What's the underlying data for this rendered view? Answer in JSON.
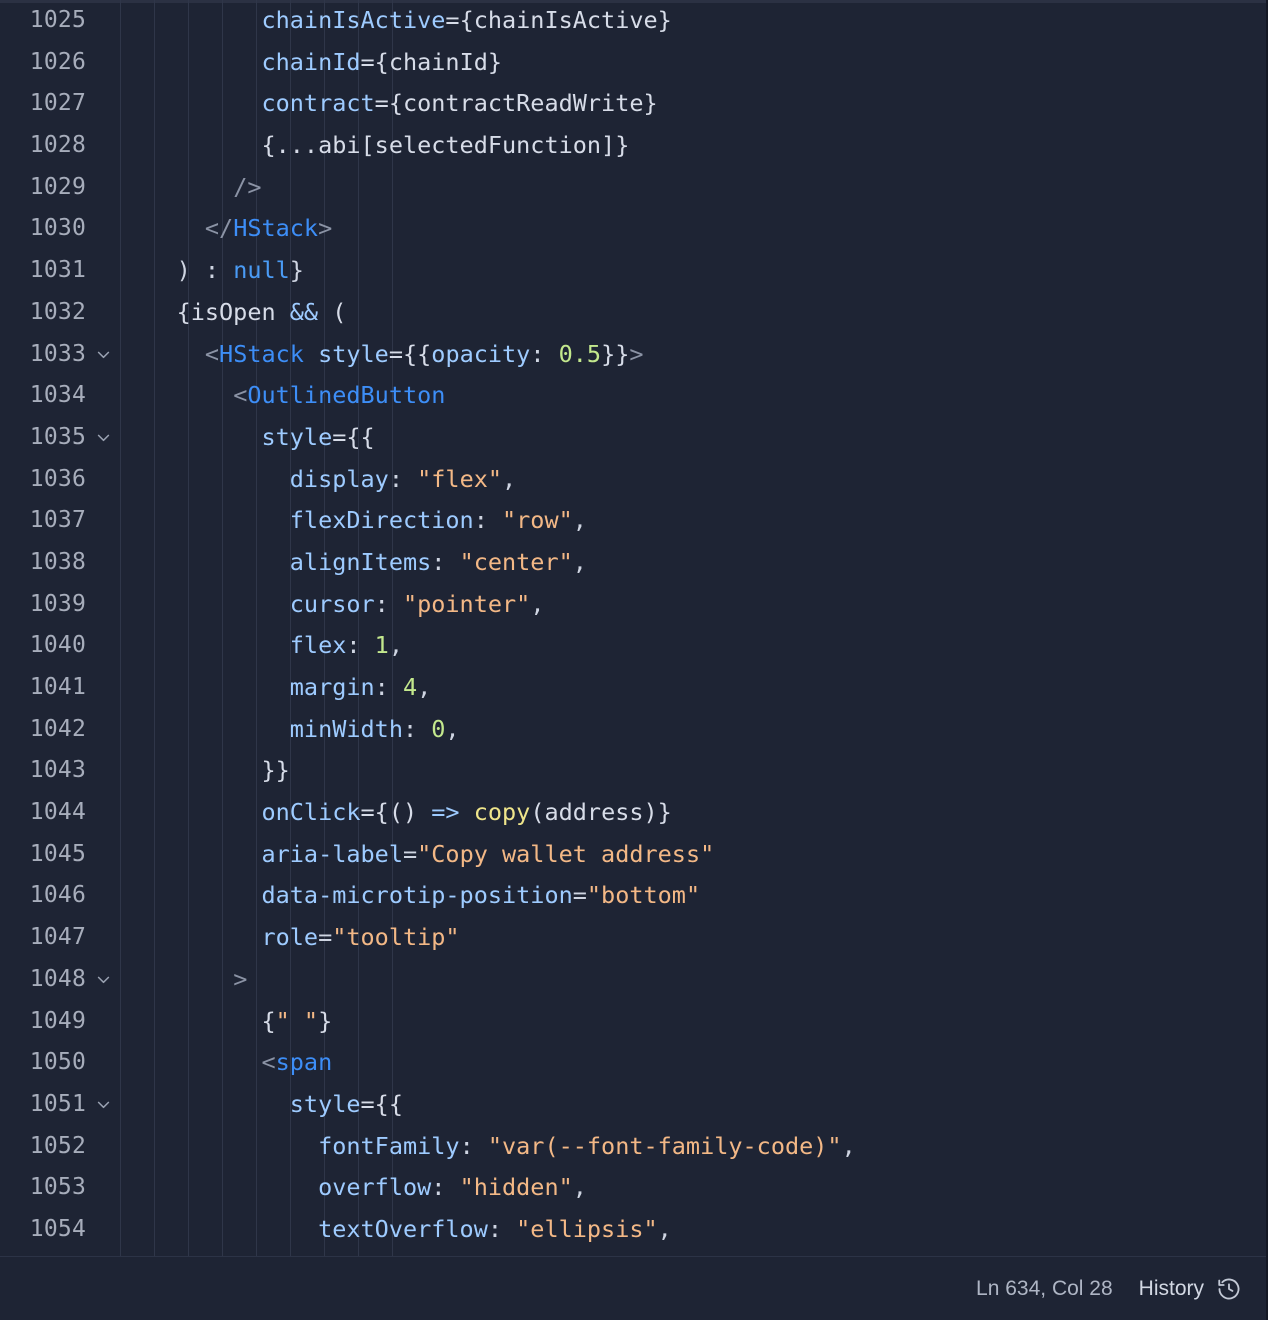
{
  "editor": {
    "language": "jsx",
    "theme_background": "#1e2434",
    "indent_guide_color": "#2f3649",
    "first_line_number": 1025,
    "indent_guide_x": [
      120,
      154,
      188,
      222,
      256,
      290,
      324,
      358,
      392
    ],
    "lines": [
      {
        "number": "1025",
        "fold": false,
        "tokens": [
          {
            "text": "          ",
            "kind": "plain"
          },
          {
            "text": "chainIsActive",
            "kind": "attr"
          },
          {
            "text": "={chainIsActive}",
            "kind": "plain"
          }
        ]
      },
      {
        "number": "1026",
        "fold": false,
        "tokens": [
          {
            "text": "          ",
            "kind": "plain"
          },
          {
            "text": "chainId",
            "kind": "attr"
          },
          {
            "text": "={chainId}",
            "kind": "plain"
          }
        ]
      },
      {
        "number": "1027",
        "fold": false,
        "tokens": [
          {
            "text": "          ",
            "kind": "plain"
          },
          {
            "text": "contract",
            "kind": "attr"
          },
          {
            "text": "={contractReadWrite}",
            "kind": "plain"
          }
        ]
      },
      {
        "number": "1028",
        "fold": false,
        "tokens": [
          {
            "text": "          ",
            "kind": "plain"
          },
          {
            "text": "{...abi[selectedFunction]}",
            "kind": "plain"
          }
        ]
      },
      {
        "number": "1029",
        "fold": false,
        "tokens": [
          {
            "text": "        ",
            "kind": "plain"
          },
          {
            "text": "/>",
            "kind": "bracket"
          }
        ]
      },
      {
        "number": "1030",
        "fold": false,
        "tokens": [
          {
            "text": "      ",
            "kind": "plain"
          },
          {
            "text": "</",
            "kind": "bracket"
          },
          {
            "text": "HStack",
            "kind": "tag"
          },
          {
            "text": ">",
            "kind": "bracket"
          }
        ]
      },
      {
        "number": "1031",
        "fold": false,
        "tokens": [
          {
            "text": "    ",
            "kind": "plain"
          },
          {
            "text": ") : ",
            "kind": "punct"
          },
          {
            "text": "null",
            "kind": "keyword"
          },
          {
            "text": "}",
            "kind": "punct"
          }
        ]
      },
      {
        "number": "1032",
        "fold": false,
        "tokens": [
          {
            "text": "    ",
            "kind": "plain"
          },
          {
            "text": "{isOpen ",
            "kind": "plain"
          },
          {
            "text": "&&",
            "kind": "op"
          },
          {
            "text": " (",
            "kind": "plain"
          }
        ]
      },
      {
        "number": "1033",
        "fold": true,
        "tokens": [
          {
            "text": "      ",
            "kind": "plain"
          },
          {
            "text": "<",
            "kind": "bracket"
          },
          {
            "text": "HStack",
            "kind": "tag"
          },
          {
            "text": " ",
            "kind": "plain"
          },
          {
            "text": "style",
            "kind": "attr"
          },
          {
            "text": "={{",
            "kind": "plain"
          },
          {
            "text": "opacity",
            "kind": "prop"
          },
          {
            "text": ": ",
            "kind": "punct"
          },
          {
            "text": "0.5",
            "kind": "number"
          },
          {
            "text": "}}",
            "kind": "plain"
          },
          {
            "text": ">",
            "kind": "bracket"
          }
        ]
      },
      {
        "number": "1034",
        "fold": false,
        "tokens": [
          {
            "text": "        ",
            "kind": "plain"
          },
          {
            "text": "<",
            "kind": "bracket"
          },
          {
            "text": "OutlinedButton",
            "kind": "tag"
          }
        ]
      },
      {
        "number": "1035",
        "fold": true,
        "tokens": [
          {
            "text": "          ",
            "kind": "plain"
          },
          {
            "text": "style",
            "kind": "attr"
          },
          {
            "text": "={{",
            "kind": "plain"
          }
        ]
      },
      {
        "number": "1036",
        "fold": false,
        "tokens": [
          {
            "text": "            ",
            "kind": "plain"
          },
          {
            "text": "display",
            "kind": "prop"
          },
          {
            "text": ": ",
            "kind": "punct"
          },
          {
            "text": "\"flex\"",
            "kind": "string"
          },
          {
            "text": ",",
            "kind": "punct"
          }
        ]
      },
      {
        "number": "1037",
        "fold": false,
        "tokens": [
          {
            "text": "            ",
            "kind": "plain"
          },
          {
            "text": "flexDirection",
            "kind": "prop"
          },
          {
            "text": ": ",
            "kind": "punct"
          },
          {
            "text": "\"row\"",
            "kind": "string"
          },
          {
            "text": ",",
            "kind": "punct"
          }
        ]
      },
      {
        "number": "1038",
        "fold": false,
        "tokens": [
          {
            "text": "            ",
            "kind": "plain"
          },
          {
            "text": "alignItems",
            "kind": "prop"
          },
          {
            "text": ": ",
            "kind": "punct"
          },
          {
            "text": "\"center\"",
            "kind": "string"
          },
          {
            "text": ",",
            "kind": "punct"
          }
        ]
      },
      {
        "number": "1039",
        "fold": false,
        "tokens": [
          {
            "text": "            ",
            "kind": "plain"
          },
          {
            "text": "cursor",
            "kind": "prop"
          },
          {
            "text": ": ",
            "kind": "punct"
          },
          {
            "text": "\"pointer\"",
            "kind": "string"
          },
          {
            "text": ",",
            "kind": "punct"
          }
        ]
      },
      {
        "number": "1040",
        "fold": false,
        "tokens": [
          {
            "text": "            ",
            "kind": "plain"
          },
          {
            "text": "flex",
            "kind": "prop"
          },
          {
            "text": ": ",
            "kind": "punct"
          },
          {
            "text": "1",
            "kind": "number"
          },
          {
            "text": ",",
            "kind": "punct"
          }
        ]
      },
      {
        "number": "1041",
        "fold": false,
        "tokens": [
          {
            "text": "            ",
            "kind": "plain"
          },
          {
            "text": "margin",
            "kind": "prop"
          },
          {
            "text": ": ",
            "kind": "punct"
          },
          {
            "text": "4",
            "kind": "number"
          },
          {
            "text": ",",
            "kind": "punct"
          }
        ]
      },
      {
        "number": "1042",
        "fold": false,
        "tokens": [
          {
            "text": "            ",
            "kind": "plain"
          },
          {
            "text": "minWidth",
            "kind": "prop"
          },
          {
            "text": ": ",
            "kind": "punct"
          },
          {
            "text": "0",
            "kind": "number"
          },
          {
            "text": ",",
            "kind": "punct"
          }
        ]
      },
      {
        "number": "1043",
        "fold": false,
        "tokens": [
          {
            "text": "          ",
            "kind": "plain"
          },
          {
            "text": "}}",
            "kind": "plain"
          }
        ]
      },
      {
        "number": "1044",
        "fold": false,
        "tokens": [
          {
            "text": "          ",
            "kind": "plain"
          },
          {
            "text": "onClick",
            "kind": "attr"
          },
          {
            "text": "={() ",
            "kind": "plain"
          },
          {
            "text": "=>",
            "kind": "op"
          },
          {
            "text": " ",
            "kind": "plain"
          },
          {
            "text": "copy",
            "kind": "func"
          },
          {
            "text": "(address)}",
            "kind": "plain"
          }
        ]
      },
      {
        "number": "1045",
        "fold": false,
        "tokens": [
          {
            "text": "          ",
            "kind": "plain"
          },
          {
            "text": "aria-label",
            "kind": "attr"
          },
          {
            "text": "=",
            "kind": "punct"
          },
          {
            "text": "\"Copy wallet address\"",
            "kind": "string"
          }
        ]
      },
      {
        "number": "1046",
        "fold": false,
        "tokens": [
          {
            "text": "          ",
            "kind": "plain"
          },
          {
            "text": "data-microtip-position",
            "kind": "attr"
          },
          {
            "text": "=",
            "kind": "punct"
          },
          {
            "text": "\"bottom\"",
            "kind": "string"
          }
        ]
      },
      {
        "number": "1047",
        "fold": false,
        "tokens": [
          {
            "text": "          ",
            "kind": "plain"
          },
          {
            "text": "role",
            "kind": "attr"
          },
          {
            "text": "=",
            "kind": "punct"
          },
          {
            "text": "\"tooltip\"",
            "kind": "string"
          }
        ]
      },
      {
        "number": "1048",
        "fold": true,
        "tokens": [
          {
            "text": "        ",
            "kind": "plain"
          },
          {
            "text": ">",
            "kind": "bracket"
          }
        ]
      },
      {
        "number": "1049",
        "fold": false,
        "tokens": [
          {
            "text": "          ",
            "kind": "plain"
          },
          {
            "text": "{",
            "kind": "plain"
          },
          {
            "text": "\" \"",
            "kind": "string"
          },
          {
            "text": "}",
            "kind": "plain"
          }
        ]
      },
      {
        "number": "1050",
        "fold": false,
        "tokens": [
          {
            "text": "          ",
            "kind": "plain"
          },
          {
            "text": "<",
            "kind": "bracket"
          },
          {
            "text": "span",
            "kind": "tag"
          }
        ]
      },
      {
        "number": "1051",
        "fold": true,
        "tokens": [
          {
            "text": "            ",
            "kind": "plain"
          },
          {
            "text": "style",
            "kind": "attr"
          },
          {
            "text": "={{",
            "kind": "plain"
          }
        ]
      },
      {
        "number": "1052",
        "fold": false,
        "tokens": [
          {
            "text": "              ",
            "kind": "plain"
          },
          {
            "text": "fontFamily",
            "kind": "prop"
          },
          {
            "text": ": ",
            "kind": "punct"
          },
          {
            "text": "\"var(--font-family-code)\"",
            "kind": "string"
          },
          {
            "text": ",",
            "kind": "punct"
          }
        ]
      },
      {
        "number": "1053",
        "fold": false,
        "tokens": [
          {
            "text": "              ",
            "kind": "plain"
          },
          {
            "text": "overflow",
            "kind": "prop"
          },
          {
            "text": ": ",
            "kind": "punct"
          },
          {
            "text": "\"hidden\"",
            "kind": "string"
          },
          {
            "text": ",",
            "kind": "punct"
          }
        ]
      },
      {
        "number": "1054",
        "fold": false,
        "tokens": [
          {
            "text": "              ",
            "kind": "plain"
          },
          {
            "text": "textOverflow",
            "kind": "prop"
          },
          {
            "text": ": ",
            "kind": "punct"
          },
          {
            "text": "\"ellipsis\"",
            "kind": "string"
          },
          {
            "text": ",",
            "kind": "punct"
          }
        ]
      }
    ]
  },
  "status_bar": {
    "cursor_position": "Ln 634, Col 28",
    "history_label": "History",
    "history_icon": "history-clock-icon"
  }
}
